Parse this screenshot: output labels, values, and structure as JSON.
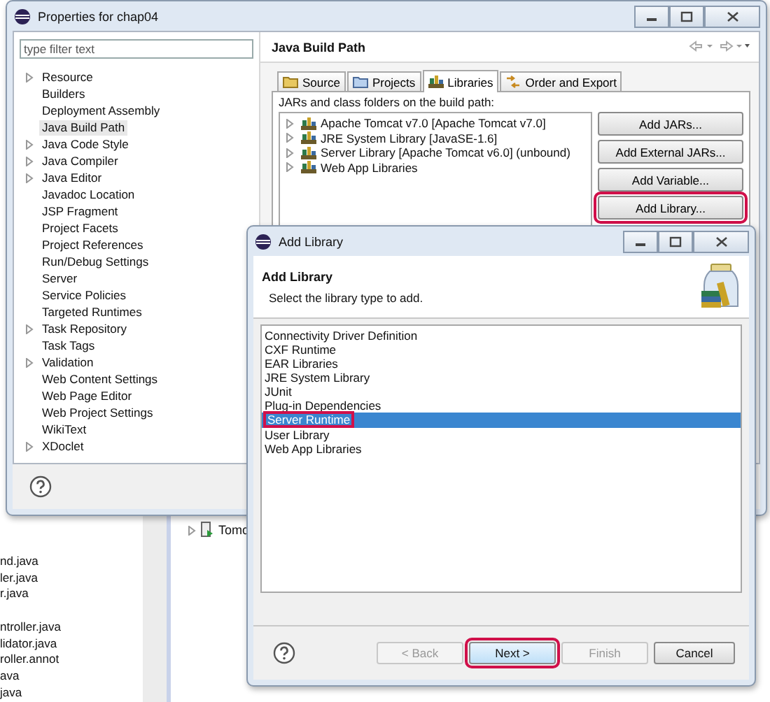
{
  "background": {
    "tree_node": {
      "label": "Tomc",
      "expandable": true
    },
    "file_groups": [
      [
        "nd.java",
        "ler.java",
        "r.java"
      ],
      [
        "ntroller.java",
        "lidator.java",
        "roller.annot",
        "ava",
        "java"
      ]
    ]
  },
  "properties_window": {
    "title": "Properties for chap04",
    "filter": {
      "placeholder": "type filter text"
    },
    "categories": [
      {
        "label": "Resource",
        "expandable": true,
        "selected": false
      },
      {
        "label": "Builders",
        "expandable": false,
        "selected": false
      },
      {
        "label": "Deployment Assembly",
        "expandable": false,
        "selected": false
      },
      {
        "label": "Java Build Path",
        "expandable": false,
        "selected": true
      },
      {
        "label": "Java Code Style",
        "expandable": true,
        "selected": false
      },
      {
        "label": "Java Compiler",
        "expandable": true,
        "selected": false
      },
      {
        "label": "Java Editor",
        "expandable": true,
        "selected": false
      },
      {
        "label": "Javadoc Location",
        "expandable": false,
        "selected": false
      },
      {
        "label": "JSP Fragment",
        "expandable": false,
        "selected": false
      },
      {
        "label": "Project Facets",
        "expandable": false,
        "selected": false
      },
      {
        "label": "Project References",
        "expandable": false,
        "selected": false
      },
      {
        "label": "Run/Debug Settings",
        "expandable": false,
        "selected": false
      },
      {
        "label": "Server",
        "expandable": false,
        "selected": false
      },
      {
        "label": "Service Policies",
        "expandable": false,
        "selected": false
      },
      {
        "label": "Targeted Runtimes",
        "expandable": false,
        "selected": false
      },
      {
        "label": "Task Repository",
        "expandable": true,
        "selected": false
      },
      {
        "label": "Task Tags",
        "expandable": false,
        "selected": false
      },
      {
        "label": "Validation",
        "expandable": true,
        "selected": false
      },
      {
        "label": "Web Content Settings",
        "expandable": false,
        "selected": false
      },
      {
        "label": "Web Page Editor",
        "expandable": false,
        "selected": false
      },
      {
        "label": "Web Project Settings",
        "expandable": false,
        "selected": false
      },
      {
        "label": "WikiText",
        "expandable": false,
        "selected": false
      },
      {
        "label": "XDoclet",
        "expandable": true,
        "selected": false
      }
    ],
    "page_title": "Java Build Path",
    "tabs": [
      {
        "label": "Source",
        "kind": "source",
        "selected": false
      },
      {
        "label": "Projects",
        "kind": "projects",
        "selected": false
      },
      {
        "label": "Libraries",
        "kind": "libraries",
        "selected": true
      },
      {
        "label": "Order and Export",
        "kind": "order",
        "selected": false
      }
    ],
    "list_label": "JARs and class folders on the build path:",
    "libraries": [
      {
        "label": "Apache Tomcat v7.0 [Apache Tomcat v7.0]",
        "expandable": true
      },
      {
        "label": "JRE System Library [JavaSE-1.6]",
        "expandable": true
      },
      {
        "label": "Server Library [Apache Tomcat v6.0] (unbound)",
        "expandable": true
      },
      {
        "label": "Web App Libraries",
        "expandable": true
      }
    ],
    "buttons": [
      {
        "label": "Add JARs...",
        "highlighted": false
      },
      {
        "label": "Add External JARs...",
        "highlighted": false
      },
      {
        "label": "Add Variable...",
        "highlighted": false
      },
      {
        "label": "Add Library...",
        "highlighted": true
      }
    ]
  },
  "add_library_dialog": {
    "title": "Add Library",
    "heading": "Add Library",
    "description": "Select the library type to add.",
    "library_types": [
      {
        "label": "Connectivity Driver Definition",
        "selected": false,
        "highlighted": false
      },
      {
        "label": "CXF Runtime",
        "selected": false,
        "highlighted": false
      },
      {
        "label": "EAR Libraries",
        "selected": false,
        "highlighted": false
      },
      {
        "label": "JRE System Library",
        "selected": false,
        "highlighted": false
      },
      {
        "label": "JUnit",
        "selected": false,
        "highlighted": false
      },
      {
        "label": "Plug-in Dependencies",
        "selected": false,
        "highlighted": false
      },
      {
        "label": "Server Runtime",
        "selected": true,
        "highlighted": true
      },
      {
        "label": "User Library",
        "selected": false,
        "highlighted": false
      },
      {
        "label": "Web App Libraries",
        "selected": false,
        "highlighted": false
      }
    ],
    "buttons": [
      {
        "label": "< Back",
        "disabled": true,
        "highlighted": false
      },
      {
        "label": "Next >",
        "disabled": false,
        "highlighted": true
      },
      {
        "label": "Finish",
        "disabled": true,
        "highlighted": false
      },
      {
        "label": "Cancel",
        "disabled": false,
        "highlighted": false
      }
    ]
  }
}
